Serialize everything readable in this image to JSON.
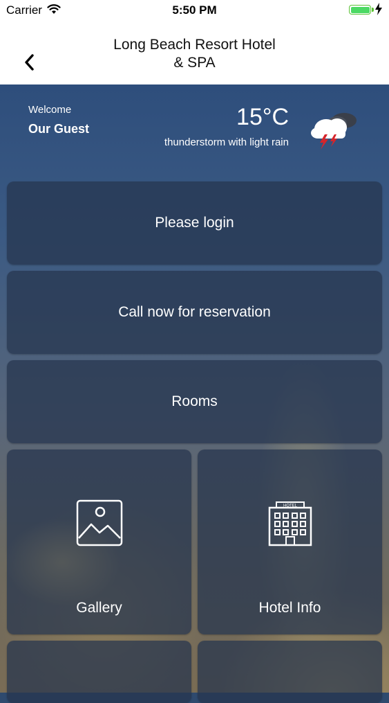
{
  "status_bar": {
    "carrier": "Carrier",
    "time": "5:50 PM"
  },
  "nav": {
    "title_line1": "Long Beach Resort Hotel",
    "title_line2": "& SPA"
  },
  "weather": {
    "welcome": "Welcome",
    "guest_name": "Our Guest",
    "temperature": "15°C",
    "condition": "thunderstorm with light rain",
    "icon": "thunderstorm-cloud-icon"
  },
  "actions": {
    "login": "Please login",
    "call": "Call now for reservation",
    "rooms": "Rooms"
  },
  "grid": [
    {
      "label": "Gallery",
      "icon": "gallery-image-icon"
    },
    {
      "label": "Hotel Info",
      "icon": "hotel-building-icon"
    }
  ],
  "colors": {
    "battery": "#4cd964",
    "tile": "#26344e"
  }
}
